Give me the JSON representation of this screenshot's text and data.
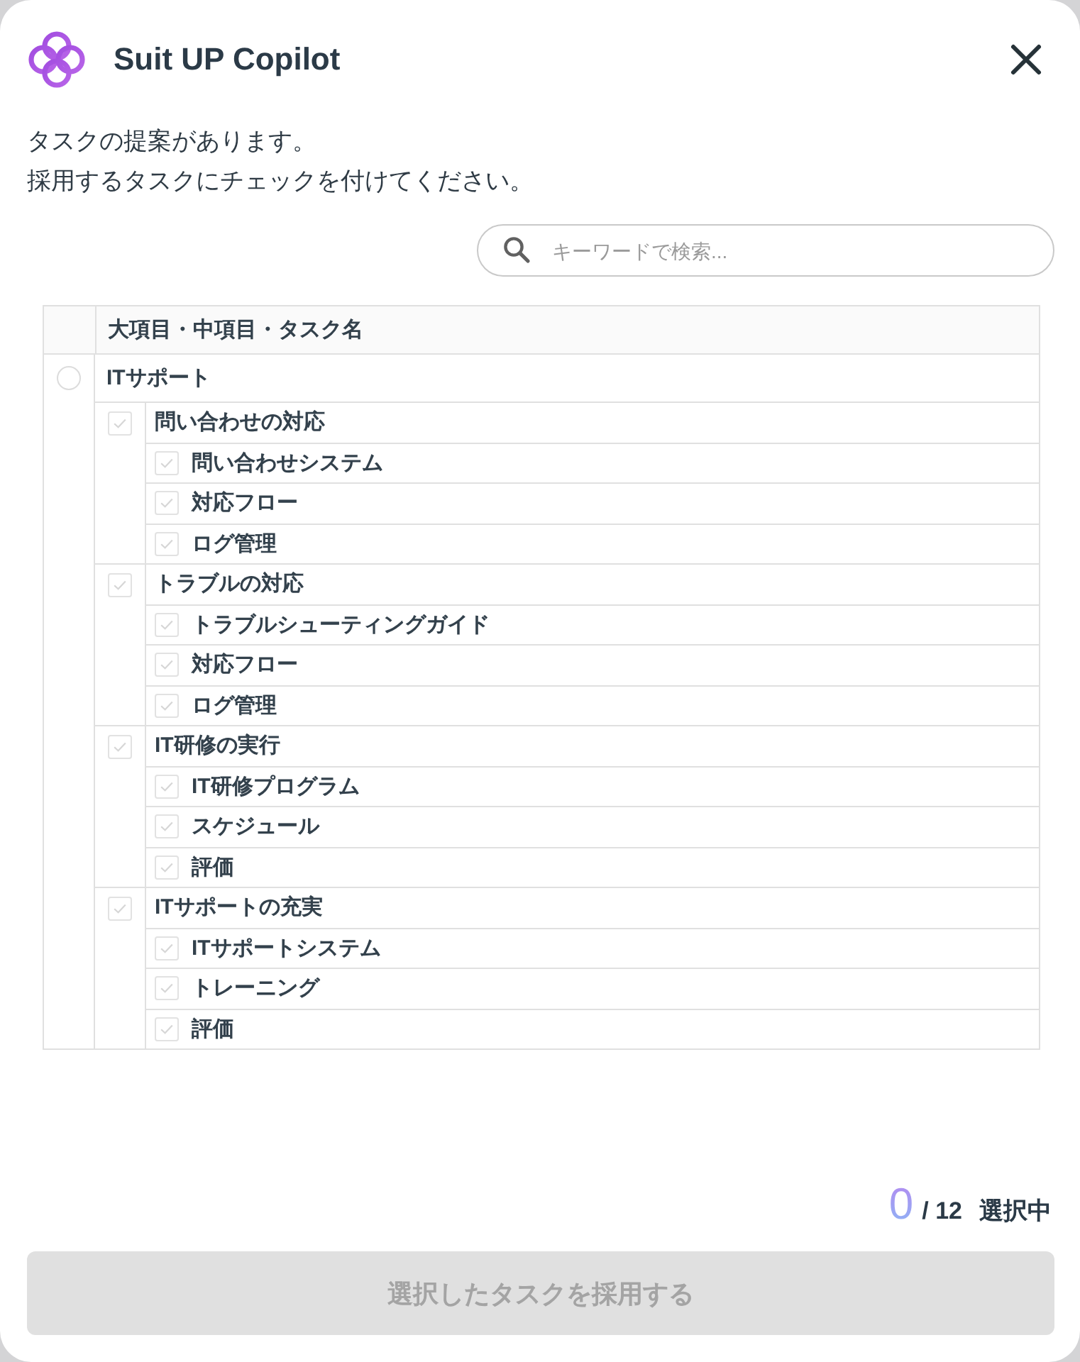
{
  "header": {
    "title": "Suit UP Copilot"
  },
  "message": [
    "タスクの提案があります。",
    "採用するタスクにチェックを付けてください。"
  ],
  "search": {
    "placeholder": "キーワードで検索..."
  },
  "table": {
    "columns": [
      "大項目・中項目・タスク名"
    ],
    "tree": [
      {
        "label": "ITサポート",
        "checked": false,
        "children": [
          {
            "label": "問い合わせの対応",
            "checked": false,
            "children": [
              {
                "label": "問い合わせシステム",
                "checked": false
              },
              {
                "label": "対応フロー",
                "checked": false
              },
              {
                "label": "ログ管理",
                "checked": false
              }
            ]
          },
          {
            "label": "トラブルの対応",
            "checked": false,
            "children": [
              {
                "label": "トラブルシューティングガイド",
                "checked": false
              },
              {
                "label": "対応フロー",
                "checked": false
              },
              {
                "label": "ログ管理",
                "checked": false
              }
            ]
          },
          {
            "label": "IT研修の実行",
            "checked": false,
            "children": [
              {
                "label": "IT研修プログラム",
                "checked": false
              },
              {
                "label": "スケジュール",
                "checked": false
              },
              {
                "label": "評価",
                "checked": false
              }
            ]
          },
          {
            "label": "ITサポートの充実",
            "checked": false,
            "children": [
              {
                "label": "ITサポートシステム",
                "checked": false
              },
              {
                "label": "トレーニング",
                "checked": false
              },
              {
                "label": "評価",
                "checked": false
              }
            ]
          }
        ]
      }
    ]
  },
  "selection": {
    "count": "0",
    "total": "/ 12",
    "label": "選択中"
  },
  "adopt_button": {
    "label": "選択したタスクを採用する",
    "disabled": true
  }
}
